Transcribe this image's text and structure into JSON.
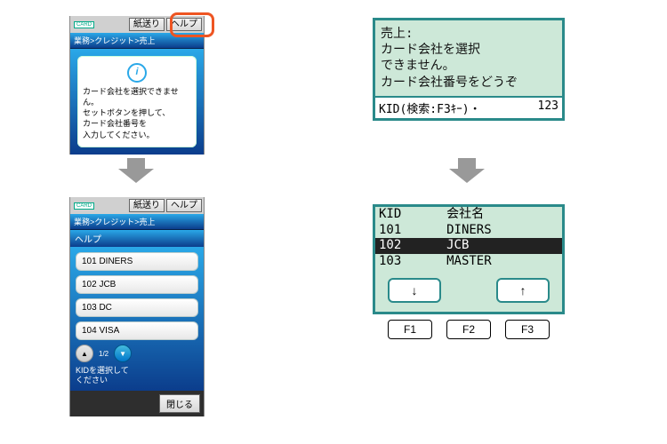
{
  "touch": {
    "card_badge": "CARD",
    "paper_btn": "紙送り",
    "help_btn": "ヘルプ",
    "crumb": "業務>クレジット>売上",
    "info_text": "カード会社を選択できません。\nセットボタンを押して、\nカード会社番号を\n入力してください。",
    "help_header": "ヘルプ",
    "help_items": [
      {
        "code": "101",
        "name": "DINERS"
      },
      {
        "code": "102",
        "name": "JCB"
      },
      {
        "code": "103",
        "name": "DC"
      },
      {
        "code": "104",
        "name": "VISA"
      }
    ],
    "page": "1/2",
    "prompt": "KIDを選択して\nください",
    "close": "閉じる"
  },
  "lcd1": {
    "lines": "売上:\nカード会社を選択\nできません。\nカード会社番号をどうぞ",
    "input_label": "KID(検索:F3ｷｰ)・",
    "input_value": "123"
  },
  "lcd2": {
    "header": {
      "kid": "KID",
      "name": "会社名"
    },
    "rows": [
      {
        "kid": "101",
        "name": "DINERS",
        "sel": false
      },
      {
        "kid": "102",
        "name": "JCB",
        "sel": true
      },
      {
        "kid": "103",
        "name": "MASTER",
        "sel": false
      }
    ],
    "soft_down": "↓",
    "soft_up": "↑",
    "fkeys": [
      "F1",
      "F2",
      "F3"
    ]
  }
}
